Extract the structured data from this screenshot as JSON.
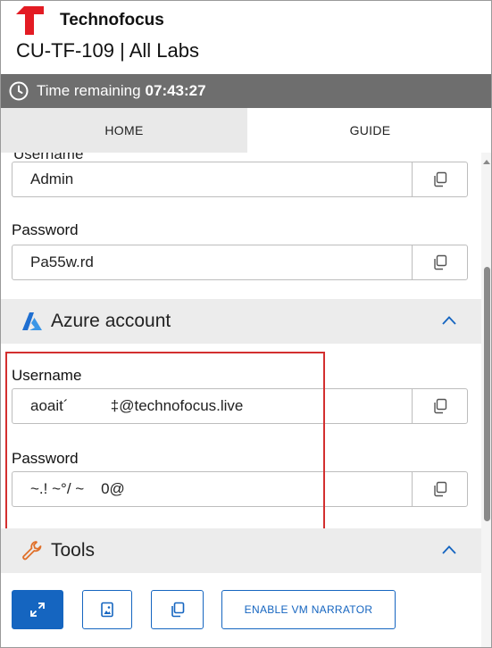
{
  "header": {
    "brand": "Technofocus",
    "lab_title": "CU-TF-109 | All Labs",
    "logo_icon": "technofocus-logo",
    "brand_color": "#e31b23"
  },
  "timer": {
    "label": "Time remaining",
    "value": "07:43:27",
    "icon": "clock-icon"
  },
  "tabs": [
    {
      "label": "HOME",
      "selected": false
    },
    {
      "label": "GUIDE",
      "selected": true
    }
  ],
  "vm_credentials": {
    "username_label": "Username",
    "username_value": "Admin",
    "password_label": "Password",
    "password_value": "Pa55w.rd"
  },
  "azure_section": {
    "title": "Azure account",
    "icon": "azure-icon",
    "username_label": "Username",
    "username_value": "aoait´          ‡@technofocus.live",
    "password_label": "Password",
    "password_value": "~.! ~°/ ~    0@"
  },
  "tools_section": {
    "title": "Tools",
    "icon": "wrench-icon",
    "buttons": [
      {
        "icon": "expand-icon"
      },
      {
        "icon": "image-icon"
      },
      {
        "icon": "copy-icon"
      },
      {
        "label": "ENABLE VM NARRATOR"
      }
    ]
  },
  "colors": {
    "timer_bg": "#6e6e6e",
    "accent": "#1565c0",
    "highlight": "#d32f2f"
  }
}
